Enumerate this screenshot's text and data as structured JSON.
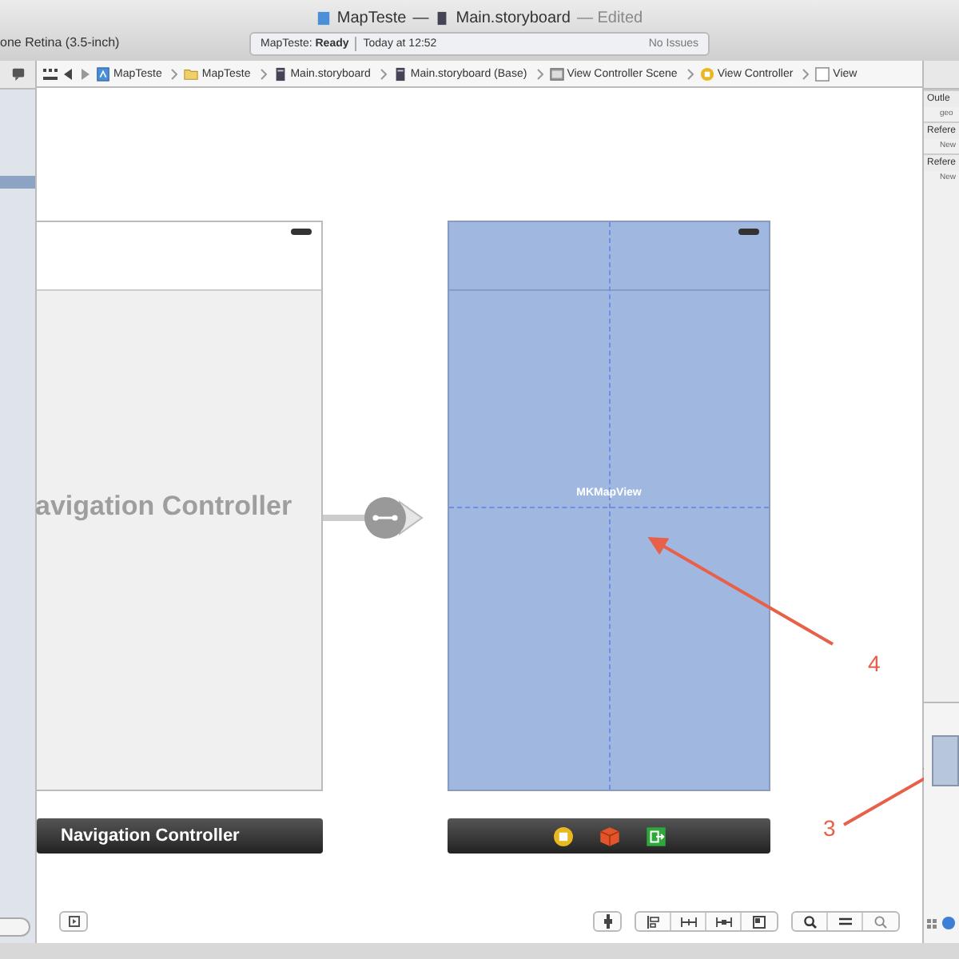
{
  "window": {
    "title_project": "MapTeste",
    "title_separator": "—",
    "title_file": "Main.storyboard",
    "title_state": "— Edited",
    "device": "one Retina (3.5-inch)"
  },
  "activity": {
    "project": "MapTeste:",
    "status": "Ready",
    "time": "Today at 12:52",
    "issues": "No Issues"
  },
  "jump_bar": [
    {
      "label": "MapTeste",
      "kind": "project"
    },
    {
      "label": "MapTeste",
      "kind": "folder"
    },
    {
      "label": "Main.storyboard",
      "kind": "file"
    },
    {
      "label": "Main.storyboard (Base)",
      "kind": "file"
    },
    {
      "label": "View Controller Scene",
      "kind": "scene"
    },
    {
      "label": "View Controller",
      "kind": "controller"
    },
    {
      "label": "View",
      "kind": "view"
    }
  ],
  "canvas": {
    "nav_controller": {
      "title": "avigation Controller",
      "label": "Navigation Controller"
    },
    "view_controller": {
      "view_label": "MKMapView"
    }
  },
  "annotations": [
    {
      "label": "4"
    },
    {
      "label": "3"
    }
  ],
  "inspector": [
    {
      "label": "Outle",
      "kind": "header"
    },
    {
      "label": "geo",
      "kind": "row"
    },
    {
      "label": "Refere",
      "kind": "header"
    },
    {
      "label": "New",
      "kind": "row"
    },
    {
      "label": "Refere",
      "kind": "header"
    },
    {
      "label": "New",
      "kind": "row"
    }
  ]
}
